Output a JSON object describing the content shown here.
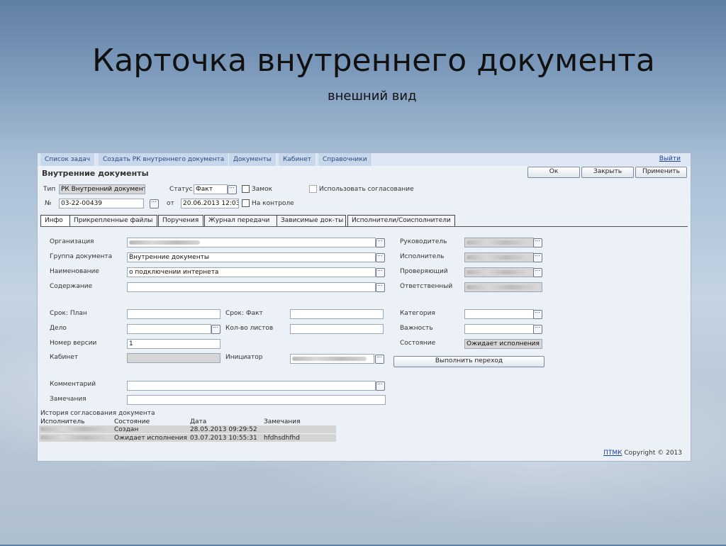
{
  "slide": {
    "title": "Карточка внутреннего документа",
    "subtitle": "внешний вид"
  },
  "menu": [
    {
      "label": "Список задач"
    },
    {
      "label": "Создать РК внутреннего документа"
    },
    {
      "label": "Документы"
    },
    {
      "label": "Кабинет"
    },
    {
      "label": "Справочники"
    }
  ],
  "exit_label": "Выйти",
  "doc_title": "Внутренние документы",
  "buttons": {
    "ok": "Ок",
    "close": "Закрыть",
    "apply": "Применить",
    "transition": "Выполнить переход"
  },
  "header": {
    "type_label": "Тип",
    "type_value": "РК Внутренний документ",
    "status_label": "Статус",
    "status_value": "Факт",
    "lock_label": "Замок",
    "approval_label": "Использовать согласование",
    "number_label": "№",
    "number_value": "03-22-00439",
    "from_label": "от",
    "date_value": "20.06.2013 12:03:1",
    "control_label": "На контроле"
  },
  "tabs": [
    {
      "label": "Инфо"
    },
    {
      "label": "Прикрепленные файлы"
    },
    {
      "label": "Поручения"
    },
    {
      "label": "Журнал передачи"
    },
    {
      "label": "Зависимые док-ты"
    },
    {
      "label": "Исполнители/Соисполнители"
    }
  ],
  "fields": {
    "organization": "Организация",
    "doc_group": "Группа документа",
    "doc_group_value": "Внутренние документы",
    "name": "Наименование",
    "name_value": "о подключении интернета",
    "content": "Содержание",
    "head": "Руководитель",
    "executor": "Исполнитель",
    "checker": "Проверяющий",
    "responsible": "Ответственный",
    "term_plan": "Срок: План",
    "term_fact": "Срок: Факт",
    "case": "Дело",
    "sheets": "Кол-во листов",
    "version": "Номер версии",
    "version_value": "1",
    "cabinet": "Кабинет",
    "initiator": "Инициатор",
    "category": "Категория",
    "importance": "Важность",
    "state": "Состояние",
    "state_value": "Ожидает исполнения",
    "comment": "Комментарий",
    "remarks": "Замечания"
  },
  "history": {
    "title": "История согласования документа",
    "columns": [
      "Исполнитель",
      "Состояние",
      "Дата",
      "Замечания"
    ],
    "rows": [
      {
        "state": "Создан",
        "date": "28.05.2013 09:29:52",
        "remark": ""
      },
      {
        "state": "Ожидает исполнения",
        "date": "03.07.2013 10:55:31",
        "remark": "hfdhsdhfhd"
      }
    ]
  },
  "footer": {
    "link": "ПТМК",
    "copyright": "Copyright © 2013"
  }
}
